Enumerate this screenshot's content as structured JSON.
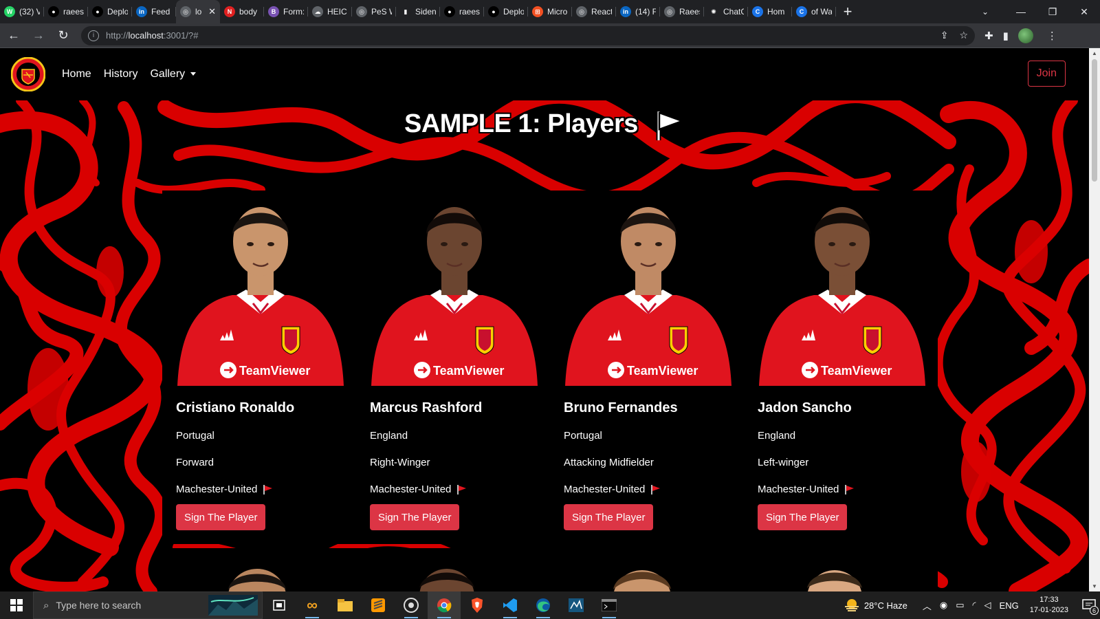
{
  "browser": {
    "tabs": [
      {
        "title": "(32) V",
        "icon": "whatsapp-icon",
        "color": "#25d366",
        "glyph": "W"
      },
      {
        "title": "raees",
        "icon": "github-icon",
        "color": "#000000",
        "glyph": "●"
      },
      {
        "title": "Deplo",
        "icon": "github-icon",
        "color": "#000000",
        "glyph": "●"
      },
      {
        "title": "Feed",
        "icon": "linkedin-icon",
        "color": "#0a66c2",
        "glyph": "in"
      },
      {
        "title": "lo",
        "icon": "globe-icon",
        "color": "#5f6368",
        "glyph": "◎",
        "active": true
      },
      {
        "title": "body",
        "icon": "pdf-icon",
        "color": "#e02020",
        "glyph": "N"
      },
      {
        "title": "Form:",
        "icon": "bootstrap-icon",
        "color": "#7952b3",
        "glyph": "B"
      },
      {
        "title": "HEIC",
        "icon": "cloud-icon",
        "color": "#5f6368",
        "glyph": "☁"
      },
      {
        "title": "PeS W",
        "icon": "globe-icon",
        "color": "#5f6368",
        "glyph": "◎"
      },
      {
        "title": "Siden",
        "icon": "sidenote-icon",
        "color": "#202124",
        "glyph": "▮"
      },
      {
        "title": "raees",
        "icon": "github-icon",
        "color": "#000000",
        "glyph": "●"
      },
      {
        "title": "Deplo",
        "icon": "github-icon",
        "color": "#000000",
        "glyph": "●"
      },
      {
        "title": "Micro",
        "icon": "microsoft-icon",
        "color": "#f25022",
        "glyph": "⊞"
      },
      {
        "title": "React",
        "icon": "globe-icon",
        "color": "#5f6368",
        "glyph": "◎"
      },
      {
        "title": "(14) F",
        "icon": "linkedin-icon",
        "color": "#0a66c2",
        "glyph": "in"
      },
      {
        "title": "Raees",
        "icon": "globe-icon",
        "color": "#5f6368",
        "glyph": "◎"
      },
      {
        "title": "ChatG",
        "icon": "openai-icon",
        "color": "#202124",
        "glyph": "✺"
      },
      {
        "title": "Hom",
        "icon": "c-icon",
        "color": "#1a73e8",
        "glyph": "C"
      },
      {
        "title": "of Wa",
        "icon": "c-icon",
        "color": "#1a73e8",
        "glyph": "C"
      }
    ],
    "url_scheme": "http://",
    "url_host": "localhost",
    "url_rest": ":3001/?#"
  },
  "site": {
    "nav": {
      "home": "Home",
      "history": "History",
      "gallery": "Gallery",
      "join": "Join"
    },
    "hero_title": "SAMPLE 1: Players",
    "players": [
      {
        "name": "Cristiano Ronaldo",
        "nation": "Portugal",
        "position": "Forward",
        "club": "Machester-United",
        "button": "Sign The Player",
        "skin": "#c9956c",
        "hair": "#1a1410"
      },
      {
        "name": "Marcus Rashford",
        "nation": "England",
        "position": "Right-Winger",
        "club": "Machester-United",
        "button": "Sign The Player",
        "skin": "#6b4530",
        "hair": "#120b08"
      },
      {
        "name": "Bruno Fernandes",
        "nation": "Portugal",
        "position": "Attacking Midfielder",
        "club": "Machester-United",
        "button": "Sign The Player",
        "skin": "#c08a65",
        "hair": "#1c1410"
      },
      {
        "name": "Jadon Sancho",
        "nation": "England",
        "position": "Left-winger",
        "club": "Machester-United",
        "button": "Sign The Player",
        "skin": "#7a4f36",
        "hair": "#100b08"
      }
    ],
    "sponsor": "TeamViewer",
    "kit_brand": "adidas"
  },
  "taskbar": {
    "search_placeholder": "Type here to search",
    "weather": "28°C  Haze",
    "lang": "ENG",
    "time": "17:33",
    "date": "17-01-2023",
    "notif_count": "6"
  },
  "colors": {
    "accent_red": "#dc3545",
    "kit_red": "#e0141e",
    "swirl_red": "#d90000"
  }
}
